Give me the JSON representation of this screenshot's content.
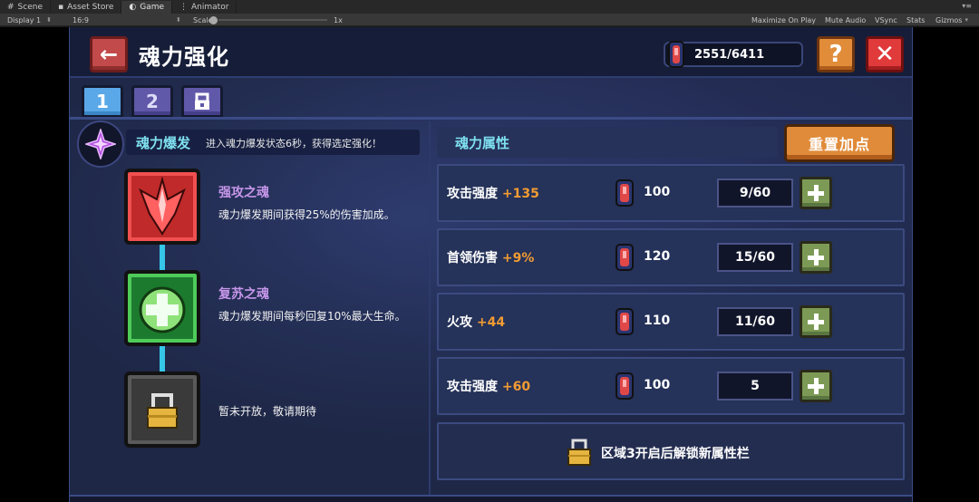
{
  "editor": {
    "tabs": [
      {
        "label": "Scene",
        "icon": "grid-icon"
      },
      {
        "label": "Asset Store",
        "icon": "store-icon"
      },
      {
        "label": "Game",
        "icon": "gamepad-icon"
      },
      {
        "label": "Animator",
        "icon": "animator-icon"
      }
    ],
    "toolbar": {
      "display": "Display 1",
      "aspect": "16:9",
      "scale_label": "Scale",
      "scale_value": "1x",
      "maximize_on_play": "Maximize On Play",
      "mute_audio": "Mute Audio",
      "vsync": "VSync",
      "stats": "Stats",
      "gizmos": "Gizmos"
    }
  },
  "header": {
    "title": "魂力强化",
    "currency": "2551/6411"
  },
  "tabs": [
    "1",
    "2"
  ],
  "burst": {
    "title": "魂力爆发",
    "description": "进入魂力爆发状态6秒，获得选定强化！"
  },
  "souls": [
    {
      "title": "强攻之魂",
      "description": "魂力爆发期间获得25%的伤害加成。"
    },
    {
      "title": "复苏之魂",
      "description": "魂力爆发期间每秒回复10%最大生命。"
    },
    {
      "title": "",
      "description": "暂未开放，敬请期待"
    }
  ],
  "attributes": {
    "title": "魂力属性",
    "reset_label": "重置加点",
    "rows": [
      {
        "name": "攻击强度",
        "bonus": "+135",
        "cost": "100",
        "level": "9/60"
      },
      {
        "name": "首领伤害",
        "bonus": "+9%",
        "cost": "120",
        "level": "15/60"
      },
      {
        "name": "火攻",
        "bonus": "+44",
        "cost": "110",
        "level": "11/60"
      },
      {
        "name": "攻击强度",
        "bonus": "+60",
        "cost": "100",
        "level": "5"
      }
    ],
    "locked_text": "区域3开启后解锁新属性栏"
  },
  "colors": {
    "panel": "#1e2746",
    "accent_cyan": "#7fe0ef",
    "bonus_orange": "#f29c32",
    "soul_title_purple": "#c797ea"
  }
}
